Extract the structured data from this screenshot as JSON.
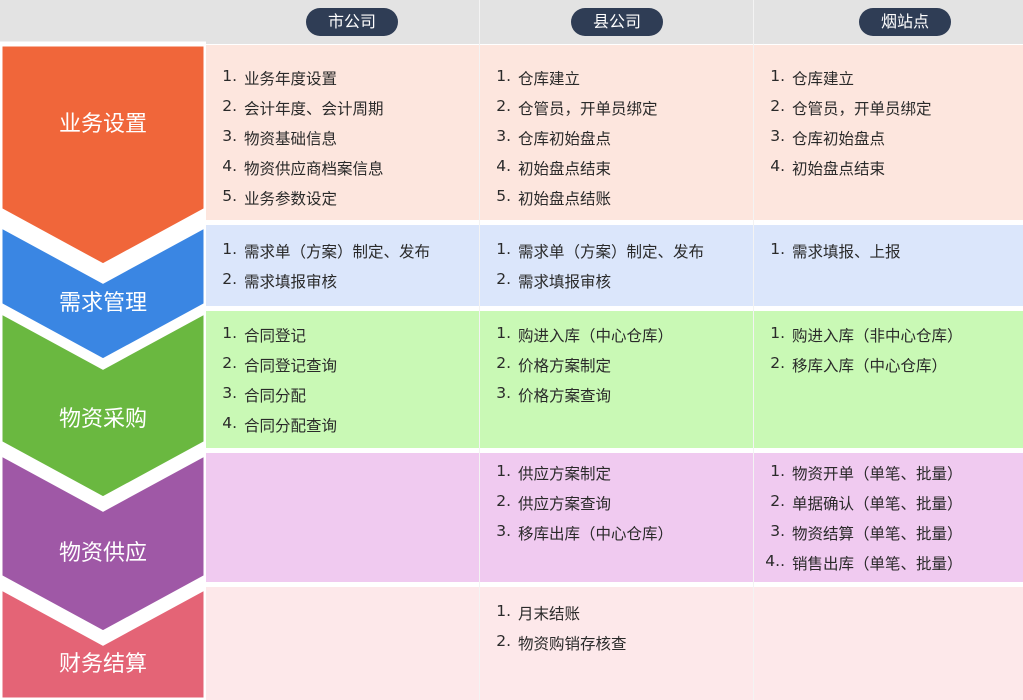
{
  "columns": [
    "市公司",
    "县公司",
    "烟站点"
  ],
  "colors": {
    "header_bg": "#e3e3e3",
    "pill_bg": "#2f3d55",
    "row_bg": [
      "#fde6de",
      "#dbe6fb",
      "#c9f9b5",
      "#f0caf0",
      "#fde8ea"
    ],
    "chevron": [
      "#f0663a",
      "#3a86e3",
      "#6ab840",
      "#9f58a6",
      "#e46476"
    ]
  },
  "categories": [
    {
      "label": "业务设置",
      "cells": [
        [
          {
            "n": "1.",
            "t": "业务年度设置"
          },
          {
            "n": "2.",
            "t": "会计年度、会计周期"
          },
          {
            "n": "3.",
            "t": "物资基础信息"
          },
          {
            "n": "4.",
            "t": "物资供应商档案信息"
          },
          {
            "n": "5.",
            "t": "业务参数设定"
          }
        ],
        [
          {
            "n": "1.",
            "t": "仓库建立"
          },
          {
            "n": "2.",
            "t": "仓管员，开单员绑定"
          },
          {
            "n": "3.",
            "t": "仓库初始盘点"
          },
          {
            "n": "4.",
            "t": "初始盘点结束"
          },
          {
            "n": "5.",
            "t": "初始盘点结账"
          }
        ],
        [
          {
            "n": "1.",
            "t": "仓库建立"
          },
          {
            "n": "2.",
            "t": "仓管员，开单员绑定"
          },
          {
            "n": "3.",
            "t": "仓库初始盘点"
          },
          {
            "n": "4.",
            "t": "初始盘点结束"
          }
        ]
      ]
    },
    {
      "label": "需求管理",
      "cells": [
        [
          {
            "n": "1.",
            "t": "需求单（方案）制定、发布"
          },
          {
            "n": "2.",
            "t": "需求填报审核"
          }
        ],
        [
          {
            "n": "1.",
            "t": "需求单（方案）制定、发布"
          },
          {
            "n": "2.",
            "t": "需求填报审核"
          }
        ],
        [
          {
            "n": "1.",
            "t": "需求填报、上报"
          }
        ]
      ]
    },
    {
      "label": "物资采购",
      "cells": [
        [
          {
            "n": "1.",
            "t": "合同登记"
          },
          {
            "n": "2.",
            "t": "合同登记查询"
          },
          {
            "n": "3.",
            "t": "合同分配"
          },
          {
            "n": "4.",
            "t": "合同分配查询"
          }
        ],
        [
          {
            "n": "1.",
            "t": "购进入库（中心仓库）"
          },
          {
            "n": "2.",
            "t": "价格方案制定"
          },
          {
            "n": "3.",
            "t": "价格方案查询"
          }
        ],
        [
          {
            "n": "1.",
            "t": "购进入库（非中心仓库）"
          },
          {
            "n": "2.",
            "t": "移库入库（中心仓库）"
          }
        ]
      ]
    },
    {
      "label": "物资供应",
      "cells": [
        [],
        [
          {
            "n": "1.",
            "t": "供应方案制定"
          },
          {
            "n": "2.",
            "t": "供应方案查询"
          },
          {
            "n": "3.",
            "t": "移库出库（中心仓库）"
          }
        ],
        [
          {
            "n": "1.",
            "t": "物资开单（单笔、批量）"
          },
          {
            "n": "2.",
            "t": "单据确认（单笔、批量）"
          },
          {
            "n": "3.",
            "t": "物资结算（单笔、批量）"
          },
          {
            "n": "4..",
            "t": "销售出库（单笔、批量）"
          }
        ]
      ]
    },
    {
      "label": "财务结算",
      "cells": [
        [],
        [
          {
            "n": "1.",
            "t": "月末结账"
          },
          {
            "n": "2.",
            "t": "物资购销存核查"
          }
        ],
        []
      ]
    }
  ]
}
